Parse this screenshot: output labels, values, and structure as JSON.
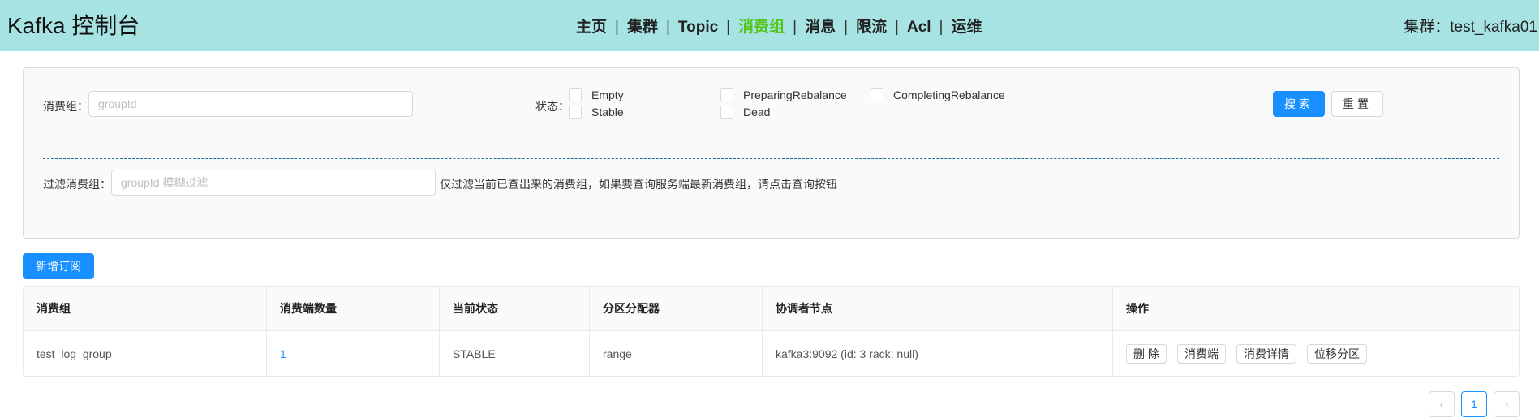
{
  "header": {
    "title": "Kafka 控制台",
    "nav": [
      {
        "label": "主页",
        "active": false
      },
      {
        "label": "集群",
        "active": false
      },
      {
        "label": "Topic",
        "active": false
      },
      {
        "label": "消费组",
        "active": true
      },
      {
        "label": "消息",
        "active": false
      },
      {
        "label": "限流",
        "active": false
      },
      {
        "label": "Acl",
        "active": false
      },
      {
        "label": "运维",
        "active": false
      }
    ],
    "separator": "|",
    "cluster": "集群：test_kafka01"
  },
  "search": {
    "group_label": "消费组：",
    "group_placeholder": "groupId",
    "group_value": "",
    "status_label": "状态：",
    "statuses": [
      "Empty",
      "Stable",
      "PreparingRebalance",
      "Dead",
      "CompletingRebalance"
    ],
    "search_button": "搜索",
    "reset_button": "重置",
    "filter_label": "过滤消费组：",
    "filter_placeholder": "groupId 模糊过滤",
    "filter_hint": "仅过滤当前已查出来的消费组，如果要查询服务端最新消费组，请点击查询按钮"
  },
  "actions": {
    "add_subscription": "新增订阅"
  },
  "table": {
    "columns": [
      "消费组",
      "消费端数量",
      "当前状态",
      "分区分配器",
      "协调者节点",
      "操作"
    ],
    "rows": [
      {
        "group": "test_log_group",
        "consumers": "1",
        "state": "STABLE",
        "assignor": "range",
        "coordinator": "kafka3:9092 (id: 3 rack: null)",
        "ops": [
          "删除",
          "消费端",
          "消费详情",
          "位移分区"
        ]
      }
    ]
  },
  "pagination": {
    "prev": "‹",
    "current": "1",
    "next": "›"
  },
  "colors": {
    "header_bg": "#a6e3e2",
    "active_nav": "#52c41a",
    "primary": "#1890ff"
  }
}
